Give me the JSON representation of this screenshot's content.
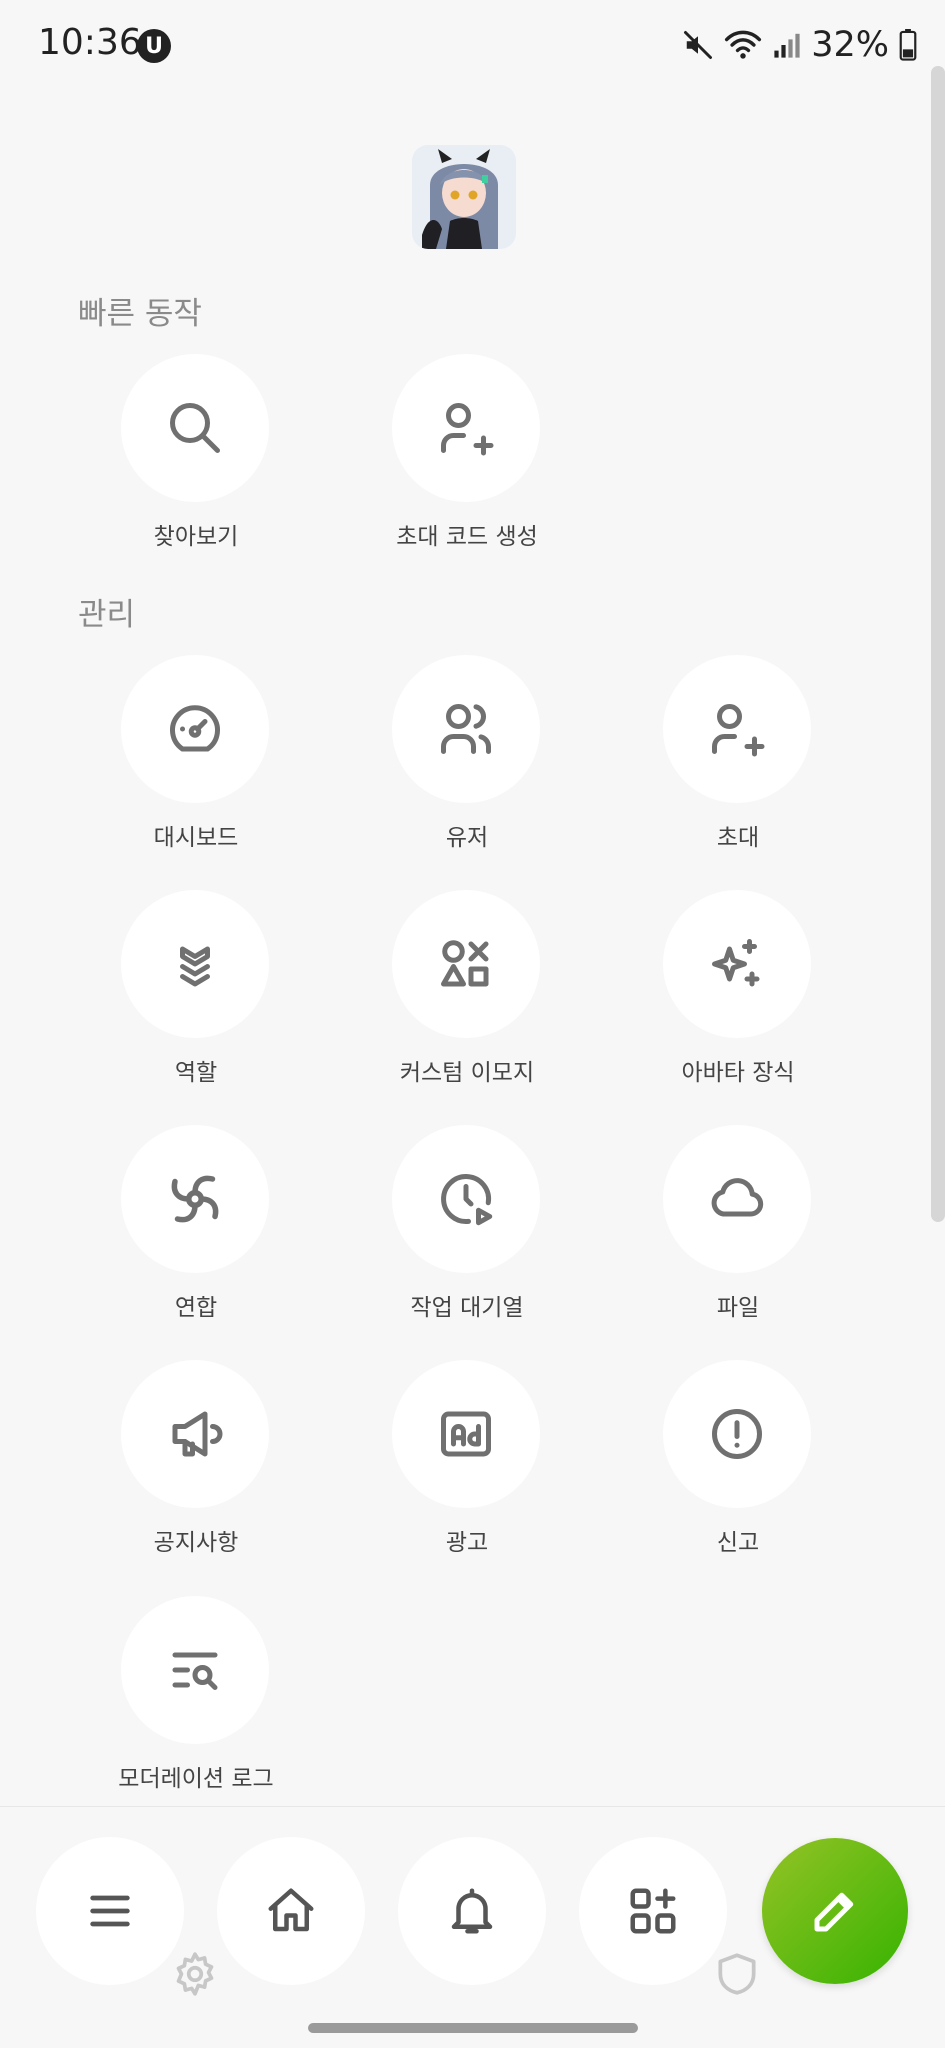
{
  "status_bar": {
    "time": "10:36",
    "badge": "U",
    "battery": "32%"
  },
  "sections": {
    "quick_actions": "빠른 동작",
    "management": "관리"
  },
  "quick_actions": [
    {
      "label": "찾아보기",
      "icon": "search-icon"
    },
    {
      "label": "초대 코드 생성",
      "icon": "user-plus-icon"
    }
  ],
  "management": [
    {
      "label": "대시보드",
      "icon": "gauge-icon"
    },
    {
      "label": "유저",
      "icon": "users-icon"
    },
    {
      "label": "초대",
      "icon": "user-plus-icon"
    },
    {
      "label": "역할",
      "icon": "chevrons-badge-icon"
    },
    {
      "label": "커스텀 이모지",
      "icon": "shapes-icon"
    },
    {
      "label": "아바타 장식",
      "icon": "sparkles-icon"
    },
    {
      "label": "연합",
      "icon": "federation-swirl-icon"
    },
    {
      "label": "작업 대기열",
      "icon": "clock-play-icon"
    },
    {
      "label": "파일",
      "icon": "cloud-icon"
    },
    {
      "label": "공지사항",
      "icon": "megaphone-icon"
    },
    {
      "label": "광고",
      "icon": "ad-icon"
    },
    {
      "label": "신고",
      "icon": "alert-circle-icon"
    },
    {
      "label": "모더레이션 로그",
      "icon": "list-search-icon"
    }
  ],
  "bottom_nav": {
    "items": [
      "menu-icon",
      "home-icon",
      "bell-icon",
      "widgets-icon"
    ],
    "fab": "pencil-icon"
  },
  "colors": {
    "background": "#f7f7f7",
    "tile": "#ffffff",
    "icon": "#707070",
    "fab_start": "#95c326",
    "fab_end": "#36b300"
  }
}
